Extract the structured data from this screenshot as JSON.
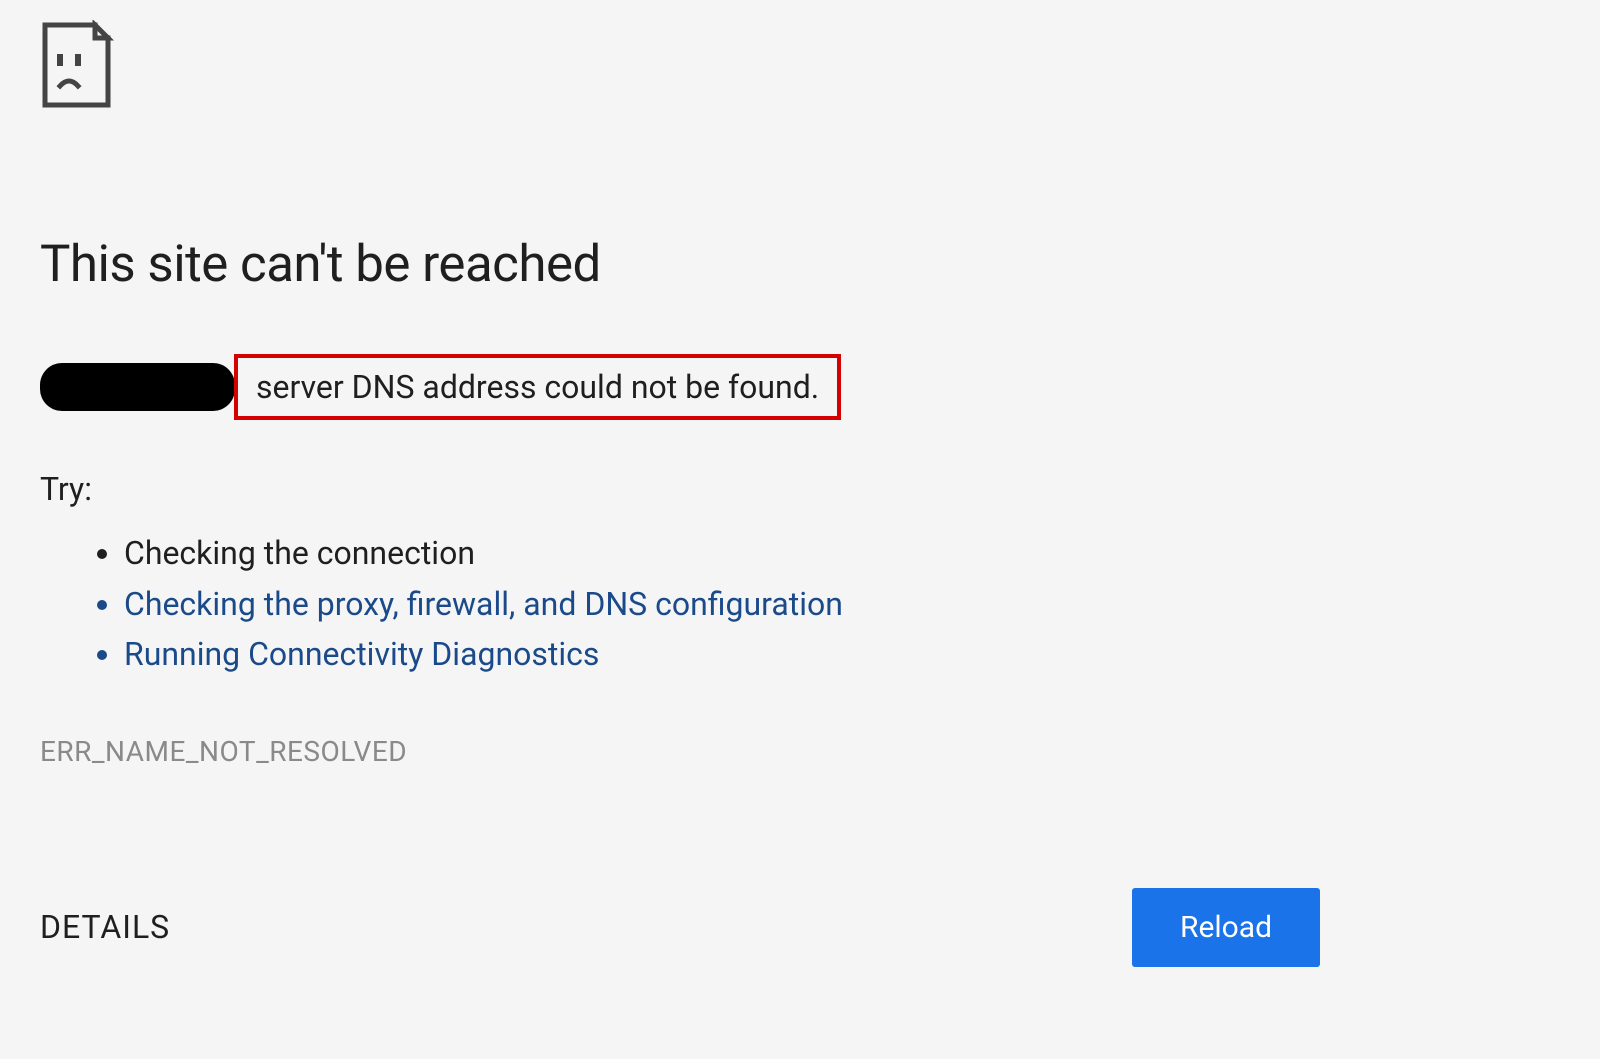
{
  "heading": "This site can't be reached",
  "error_message": "server DNS address could not be found.",
  "try_label": "Try:",
  "suggestions": [
    {
      "text": "Checking the connection",
      "link": false
    },
    {
      "text": "Checking the proxy, firewall, and DNS configuration",
      "link": true
    },
    {
      "text": "Running Connectivity Diagnostics",
      "link": true
    }
  ],
  "error_code": "ERR_NAME_NOT_RESOLVED",
  "details_label": "DETAILS",
  "reload_label": "Reload"
}
